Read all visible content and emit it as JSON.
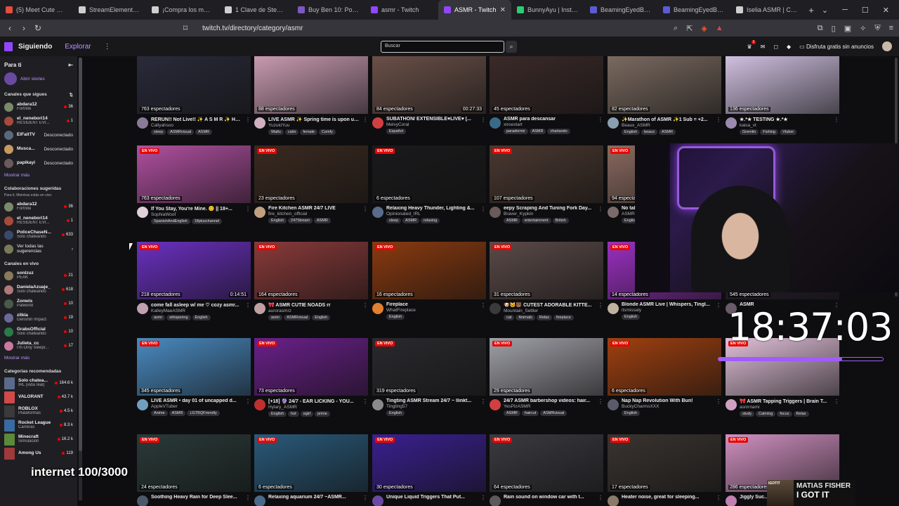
{
  "browser": {
    "tabs": [
      {
        "label": "(5) Meet Cute Cafe",
        "color": "#e74c3c"
      },
      {
        "label": "StreamElements - d",
        "color": "#cfcfcf"
      },
      {
        "label": "¡Compra los mejore",
        "color": "#cfcfcf"
      },
      {
        "label": "1 Clave de Steam A",
        "color": "#cfcfcf"
      },
      {
        "label": "Buy Ben 10: Power T",
        "color": "#7e57c2"
      },
      {
        "label": "asmr - Twitch",
        "color": "#9147ff"
      },
      {
        "label": "ASMR - Twitch",
        "color": "#9147ff",
        "active": true
      },
      {
        "label": "BunnyAyu | Instagr",
        "color": "#2ecc71"
      },
      {
        "label": "BeamingEyedBunny",
        "color": "#5b5bd6"
      },
      {
        "label": "BeamingEyedBunny",
        "color": "#5b5bd6"
      },
      {
        "label": "Iselia ASMR | Creat",
        "color": "#cfcfcf"
      }
    ],
    "url": "twitch.tv/directory/category/asmr"
  },
  "topnav": {
    "following": "Siguiendo",
    "explore": "Explorar",
    "search_placeholder": "Buscar",
    "promo": "Disfruta gratis sin anuncios",
    "notif_badge": "3"
  },
  "sidebar": {
    "for_you": "Para ti",
    "open_stories": "Abrir stories",
    "followed_header": "Canales que sigues",
    "followed": [
      {
        "name": "abdara12",
        "game": "Fortnite",
        "count": "36",
        "color": "#7a8a6a"
      },
      {
        "name": "el_nenebori14",
        "game": "RESIDENT EVI...",
        "count": "1",
        "color": "#a84a3a"
      },
      {
        "name": "ElFaitTV",
        "offline": "Desconectado",
        "color": "#5a6a7a"
      },
      {
        "name": "Musca...",
        "offline": "Desconectado",
        "color": "#c89a60"
      },
      {
        "name": "papikayi",
        "offline": "Desconectado",
        "color": "#6a5a5a"
      }
    ],
    "show_more": "Mostrar más",
    "collab_header": "Colaboraciones sugeridas",
    "collab_sub": "Para ti. Mientras estás en vivo.",
    "collab": [
      {
        "name": "abdara12",
        "game": "Fortnite",
        "count": "36",
        "color": "#7a8a6a"
      },
      {
        "name": "el_nenebori14",
        "game": "RESIDENT EVI...",
        "count": "1",
        "color": "#a84a3a"
      },
      {
        "name": "PoliceChaseN...",
        "game": "Solo chateando",
        "count": "633",
        "color": "#3a4a6a"
      }
    ],
    "see_all": "Ver todas las sugerencias",
    "live_header": "Canales en vivo",
    "live": [
      {
        "name": "sonlzuz",
        "game": "PEAK",
        "count": "21",
        "color": "#8a7a5a"
      },
      {
        "name": "DanielaAzuaje_",
        "game": "Solo chateando",
        "count": "618",
        "color": "#b07a7a"
      },
      {
        "name": "Zonwis",
        "game": "Palworld",
        "count": "10",
        "color": "#4a5a4a"
      },
      {
        "name": "zilkia",
        "game": "Genshin Impact",
        "count": "19",
        "color": "#6a6a9a"
      },
      {
        "name": "GrabsOfficial",
        "game": "Solo chateando",
        "count": "10",
        "color": "#2a7a4a"
      },
      {
        "name": "Julieta_cc",
        "game": "I'm Only Sleepi...",
        "count": "17",
        "color": "#c87aa0"
      }
    ],
    "show_more2": "Mostrar más",
    "cats_header": "Categorías recomendadas",
    "cats": [
      {
        "name": "Solo chatea...",
        "game": "IRL (vida real)",
        "count": "164.6 k",
        "color": "#5a6a8a"
      },
      {
        "name": "VALORANT",
        "game": "",
        "count": "43.7 k",
        "color": "#d04a4a"
      },
      {
        "name": "ROBLOX",
        "game": "Plataformas",
        "count": "4.5 k",
        "color": "#3a3a3a"
      },
      {
        "name": "Rocket League",
        "game": "Carreras",
        "count": "8.3 k",
        "color": "#3a6aa0"
      },
      {
        "name": "Minecraft",
        "game": "Simulación",
        "count": "16.2 k",
        "color": "#5a8a3a"
      },
      {
        "name": "Among Us",
        "game": "",
        "count": "119",
        "color": "#a03a3a"
      }
    ]
  },
  "streams": [
    {
      "title": "RERUN!! Not Live!! ✨ A S M R ✨ Ho...",
      "name": "Callyahsoo",
      "viewers": "763 espectadores",
      "tags": [
        "sleep",
        "ASMRvisual",
        "ASMR"
      ],
      "live": false,
      "bg": "#2a2a3a",
      "av": "#8a7a9a"
    },
    {
      "title": "LIVE ASMR ✨ Spring time is upon us...",
      "name": "YuzukiYuu",
      "viewers": "88 espectadores",
      "tags": [
        "Waifu",
        "calm",
        "female",
        "Comfy"
      ],
      "live": false,
      "bg": "#c89ab0",
      "av": "#d0b0c0"
    },
    {
      "title": "SUBATHON/ EXTENSIBLE♥LIVE♥ [...",
      "name": "MelvyCoral",
      "viewers": "84 espectadores",
      "tags": [
        "Español"
      ],
      "live": false,
      "bg": "#6a5048",
      "av": "#d04040",
      "time": "00:27:33"
    },
    {
      "title": "ASMR para descansar",
      "name": "xiroextart",
      "viewers": "45 espectadores",
      "tags": [
        "paradormir",
        "ASMR",
        "charlando"
      ],
      "live": false,
      "bg": "#3a2a28",
      "av": "#3a6a8a"
    },
    {
      "title": "✨Marathon of ASMR ✨1 Sub = +2...",
      "name": "Beaux_ASMR",
      "viewers": "82 espectadores",
      "tags": [
        "English",
        "beaux",
        "ASMR"
      ],
      "live": false,
      "bg": "#7a6a60",
      "av": "#8aa0b0"
    },
    {
      "title": "★.*★ TESTING ★.*★",
      "name": "kaisa_vt",
      "viewers": "136 espectadores",
      "tags": [
        "Gremlin",
        "Fishing",
        "Vtuber"
      ],
      "live": false,
      "bg": "#d0c0e0",
      "av": "#9a8ab0"
    },
    {
      "title": "If You Stay, You're Mine. 😊 || 18+...",
      "name": "SophiaWoof",
      "viewers": "763 espectadores",
      "tags": [
        "SpanishAndEnglish",
        "18pluschannel"
      ],
      "live": true,
      "bg": "#b050a0",
      "av": "#e0d0d8"
    },
    {
      "title": "Fire Kitchen ASMR 24/7 LIVE",
      "name": "fire_kitchen_official",
      "viewers": "23 espectadores",
      "tags": [
        "English",
        "247Stream",
        "ASMR"
      ],
      "live": true,
      "bg": "#3a2a20",
      "av": "#c0a080"
    },
    {
      "title": "Relaxing Heavy Thunder, Lighting &...",
      "name": "Opinionated_IRL",
      "viewers": "6 espectadores",
      "tags": [
        "sleep",
        "ASMR",
        "relaxing"
      ],
      "live": true,
      "bg": "#1a1a1c",
      "av": "#5a6a8a"
    },
    {
      "title": "eepy Scraping And Tuning Fork Day...",
      "name": "Braver_Kypkin",
      "viewers": "107 espectadores",
      "tags": [
        "ASMR",
        "entertainment",
        "British"
      ],
      "live": true,
      "bg": "#4a3830",
      "av": "#6a5a5a"
    },
    {
      "title": "No talking ASMR",
      "name": "ASMR",
      "viewers": "94 espectadores",
      "tags": [
        "English"
      ],
      "live": true,
      "bg": "#8a6a60",
      "av": "#7a6a6a"
    },
    {
      "title": "",
      "name": "",
      "viewers": "",
      "tags": [],
      "live": true,
      "bg": "#1a1420",
      "av": "#333"
    },
    {
      "title": "come fall asleep w/ me ♡ cozy asmr...",
      "name": "KalleyMaeASMR",
      "viewers": "218 espectadores",
      "tags": [
        "asmr",
        "whispering",
        "English"
      ],
      "live": true,
      "bg": "#6a30c0",
      "av": "#c0a0b0",
      "time": "0:14:51"
    },
    {
      "title": "🎀 ASMR CUTIE NOADS rr",
      "name": "aurorasmrz",
      "viewers": "164 espectadores",
      "tags": [
        "asmr",
        "ASMRvisual",
        "English"
      ],
      "live": true,
      "bg": "#8a3a3a",
      "av": "#c0a0a0"
    },
    {
      "title": "Fireplace",
      "name": "WhatFireplace",
      "viewers": "16 espectadores",
      "tags": [
        "English"
      ],
      "live": true,
      "bg": "#8a3a10",
      "av": "#e08030"
    },
    {
      "title": "🐶🐱🐻 CUTEST ADORABLE KITTE...",
      "name": "Mountain_Settler",
      "viewers": "31 espectadores",
      "tags": [
        "cat",
        "Animals",
        "Relax",
        "fireplace"
      ],
      "live": true,
      "bg": "#5a4a48",
      "av": "#3a3a3a"
    },
    {
      "title": "Blonde ASMR Live | Whispers, Tingl...",
      "name": "itsmissaly",
      "viewers": "14 espectadores",
      "tags": [
        "English"
      ],
      "live": true,
      "bg": "#9a30c0",
      "av": "#c0b0a0"
    },
    {
      "title": "ASMR",
      "name": "",
      "viewers": "545 espectadores",
      "tags": [],
      "live": true,
      "bg": "#2a2030",
      "av": "#6a5a6a"
    },
    {
      "title": "LIVE ASMR • day 01 of uncapped d...",
      "name": "AppleVTuber",
      "viewers": "345 espectadores",
      "tags": [
        "Anime",
        "ASMR",
        "LGTBQFriendly"
      ],
      "live": true,
      "bg": "#4a8ac0",
      "av": "#70a0c0"
    },
    {
      "title": "[+18] 🔮 24/7 - EAR LICKING - YOU...",
      "name": "Hylary_ASMR",
      "viewers": "73 espectadores",
      "tags": [
        "English",
        "hot",
        "egirl",
        "prime"
      ],
      "live": true,
      "bg": "#6a208a",
      "av": "#c03030"
    },
    {
      "title": "Tingting ASMR Stream 24/7 ~ llinkt...",
      "name": "Tingting57",
      "viewers": "319 espectadores",
      "tags": [
        "English"
      ],
      "live": true,
      "bg": "#2a2a2e",
      "av": "#8a8a8a"
    },
    {
      "title": "24/7 ASMR barbershop videos: hair...",
      "name": "YesPlzASMR",
      "viewers": "29 espectadores",
      "tags": [
        "ASMR",
        "haircut",
        "ASMRvisual"
      ],
      "live": true,
      "bg": "#a0a0a8",
      "av": "#d04040"
    },
    {
      "title": "Nap Nap Revolution With Bun!",
      "name": "BuckyCharmsXXX",
      "viewers": "6 espectadores",
      "tags": [
        "English"
      ],
      "live": true,
      "bg": "#a04010",
      "av": "#5a5a6a"
    },
    {
      "title": "🎀 ASMR Tapping Triggers | Brain T...",
      "name": "asmrnami",
      "viewers": "",
      "tags": [
        "study",
        "Calming",
        "focus",
        "Relax"
      ],
      "live": true,
      "bg": "#e0c0d8",
      "av": "#d0a0c0"
    },
    {
      "title": "Soothing Heavy Rain for Deep Slee...",
      "name": "",
      "viewers": "24 espectadores",
      "tags": [],
      "live": true,
      "bg": "#2a3a38",
      "av": "#4a5a6a"
    },
    {
      "title": "Relaxing aquarium 24/7 ~ASMR...",
      "name": "",
      "viewers": "6 espectadores",
      "tags": [],
      "live": true,
      "bg": "#2a5a7a",
      "av": "#4a6a8a"
    },
    {
      "title": "Unique Liquid Triggers That Put...",
      "name": "",
      "viewers": "30 espectadores",
      "tags": [],
      "live": true,
      "bg": "#3a2090",
      "av": "#6a4aa0"
    },
    {
      "title": "Rain sound on window car with t...",
      "name": "",
      "viewers": "64 espectadores",
      "tags": [],
      "live": true,
      "bg": "#3a3a40",
      "av": "#5a5a5a"
    },
    {
      "title": "Heater noise, great for sleeping...",
      "name": "",
      "viewers": "17 espectadores",
      "tags": [],
      "live": true,
      "bg": "#3a3430",
      "av": "#8a7a6a"
    },
    {
      "title": "Jiggly Suc...",
      "name": "",
      "viewers": "286 espectadores",
      "tags": [],
      "live": true,
      "bg": "#d090c0",
      "av": "#c080b0"
    }
  ],
  "live_label": "EN VIVO",
  "overlay": {
    "clock": "18:37:03",
    "clock_progress": 0.75,
    "internet": "internet 100/3000",
    "alert_name": "MATIAS FISHER",
    "alert_msg": "I GOT IT",
    "alert_tag": "IGOTIT"
  }
}
